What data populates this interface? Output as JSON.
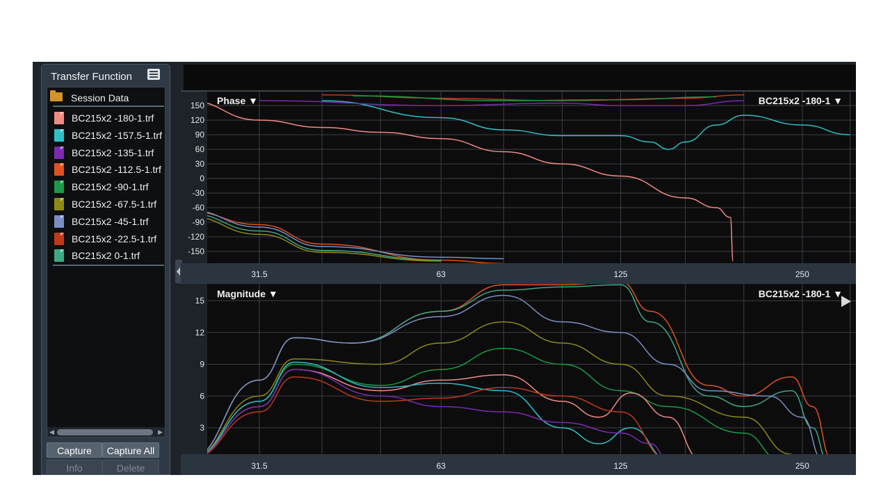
{
  "sidebar": {
    "title": "Transfer Function",
    "menu_icon": "hamburger-menu-icon",
    "folder": {
      "label": "Session Data",
      "icon": "folder-icon",
      "color": "#d4932a"
    },
    "files": [
      {
        "label": "BC215x2 -180-1.trf",
        "color": "#f08b84"
      },
      {
        "label": "BC215x2 -157.5-1.trf",
        "color": "#2cc0c4"
      },
      {
        "label": "BC215x2 -135-1.trf",
        "color": "#7a2bb0"
      },
      {
        "label": "BC215x2 -112.5-1.trf",
        "color": "#e0521f"
      },
      {
        "label": "BC215x2 -90-1.trf",
        "color": "#1a9a47"
      },
      {
        "label": "BC215x2 -67.5-1.trf",
        "color": "#8f8a16"
      },
      {
        "label": "BC215x2 -45-1.trf",
        "color": "#7b8fc2"
      },
      {
        "label": "BC215x2 -22.5-1.trf",
        "color": "#c0391b"
      },
      {
        "label": "BC215x2 0-1.trf",
        "color": "#3ea985"
      }
    ],
    "buttons": {
      "capture": "Capture",
      "capture_all": "Capture All",
      "info": "Info",
      "delete": "Delete"
    }
  },
  "phase_panel": {
    "label": "Phase ▼",
    "trace_selector": "BC215x2 -180-1 ▼"
  },
  "magnitude_panel": {
    "label": "Magnitude ▼",
    "trace_selector": "BC215x2 -180-1 ▼"
  },
  "chart_data": [
    {
      "type": "line",
      "title": "Phase",
      "xlabel": "",
      "ylabel": "",
      "x_scale": "log",
      "x_ticks": [
        "31.5",
        "63",
        "125",
        "250"
      ],
      "y_ticks": [
        150,
        120,
        90,
        60,
        30,
        0,
        -30,
        -60,
        -90,
        -120,
        -150
      ],
      "ylim": [
        -170,
        175
      ],
      "grid": true,
      "series": [
        {
          "color": "#f08b84",
          "points": [
            [
              24,
              160
            ],
            [
              31.5,
              120
            ],
            [
              40,
              105
            ],
            [
              50,
              95
            ],
            [
              63,
              82
            ],
            [
              80,
              55
            ],
            [
              100,
              30
            ],
            [
              125,
              5
            ],
            [
              160,
              -40
            ],
            [
              180,
              -60
            ],
            [
              190,
              -80
            ],
            [
              192,
              -170
            ]
          ]
        },
        {
          "color": "#2cc0c4",
          "points": [
            [
              40,
              160
            ],
            [
              63,
              125
            ],
            [
              80,
              100
            ],
            [
              100,
              88
            ],
            [
              125,
              88
            ],
            [
              140,
              75
            ],
            [
              150,
              60
            ],
            [
              160,
              75
            ],
            [
              180,
              110
            ],
            [
              200,
              130
            ],
            [
              250,
              110
            ],
            [
              300,
              90
            ]
          ]
        },
        {
          "color": "#7a2bb0",
          "points": [
            [
              31.5,
              160
            ],
            [
              63,
              150
            ],
            [
              100,
              155
            ],
            [
              125,
              150
            ],
            [
              160,
              150
            ],
            [
              200,
              160
            ]
          ]
        },
        {
          "color": "#c0391b",
          "points": [
            [
              40,
              172
            ],
            [
              63,
              165
            ],
            [
              100,
              160
            ],
            [
              160,
              165
            ],
            [
              200,
              172
            ]
          ]
        },
        {
          "color": "#1a9a47",
          "points": [
            [
              45,
              170
            ],
            [
              80,
              160
            ],
            [
              125,
              162
            ],
            [
              180,
              168
            ]
          ]
        },
        {
          "color": "#e0521f",
          "points": [
            [
              24,
              -68
            ],
            [
              31.5,
              -95
            ],
            [
              40,
              -135
            ],
            [
              63,
              -168
            ],
            [
              80,
              -175
            ]
          ]
        },
        {
          "color": "#7b8fc2",
          "points": [
            [
              24,
              -65
            ],
            [
              31.5,
              -100
            ],
            [
              40,
              -140
            ],
            [
              63,
              -162
            ],
            [
              80,
              -165
            ]
          ]
        },
        {
          "color": "#3ea985",
          "points": [
            [
              24,
              -72
            ],
            [
              31.5,
              -108
            ],
            [
              40,
              -148
            ],
            [
              63,
              -168
            ]
          ]
        },
        {
          "color": "#8f8a16",
          "points": [
            [
              24,
              -78
            ],
            [
              31.5,
              -115
            ],
            [
              40,
              -152
            ],
            [
              63,
              -170
            ]
          ]
        }
      ]
    },
    {
      "type": "line",
      "title": "Magnitude",
      "xlabel": "",
      "ylabel": "",
      "x_scale": "log",
      "x_ticks": [
        "31.5",
        "63",
        "125",
        "250"
      ],
      "y_ticks": [
        15,
        12,
        9,
        6,
        3
      ],
      "ylim": [
        0,
        16.5
      ],
      "grid": true,
      "series": [
        {
          "color": "#e0521f",
          "points": [
            [
              24,
              0
            ],
            [
              31.5,
              7.5
            ],
            [
              36,
              11.5
            ],
            [
              45,
              11
            ],
            [
              63,
              14
            ],
            [
              80,
              16.5
            ],
            [
              100,
              16.5
            ],
            [
              125,
              16.8
            ],
            [
              140,
              14
            ],
            [
              175,
              7
            ],
            [
              200,
              6
            ],
            [
              240,
              7.8
            ],
            [
              260,
              5
            ],
            [
              280,
              0
            ]
          ]
        },
        {
          "color": "#3ea985",
          "points": [
            [
              24,
              0
            ],
            [
              31.5,
              7.5
            ],
            [
              36,
              11.5
            ],
            [
              45,
              11
            ],
            [
              63,
              14
            ],
            [
              80,
              16
            ],
            [
              100,
              16.3
            ],
            [
              125,
              16.5
            ],
            [
              140,
              13
            ],
            [
              175,
              6
            ],
            [
              200,
              5
            ],
            [
              240,
              6.5
            ],
            [
              260,
              3
            ],
            [
              275,
              0
            ]
          ]
        },
        {
          "color": "#7b8fc2",
          "points": [
            [
              24,
              0
            ],
            [
              31.5,
              7.5
            ],
            [
              36,
              11.5
            ],
            [
              45,
              11
            ],
            [
              63,
              13.5
            ],
            [
              80,
              15.5
            ],
            [
              100,
              13
            ],
            [
              125,
              12
            ],
            [
              150,
              9
            ],
            [
              175,
              6.5
            ],
            [
              220,
              6
            ],
            [
              250,
              4
            ],
            [
              270,
              0
            ]
          ]
        },
        {
          "color": "#8f8a16",
          "points": [
            [
              24,
              0
            ],
            [
              31.5,
              6
            ],
            [
              36,
              9.5
            ],
            [
              50,
              9
            ],
            [
              63,
              11
            ],
            [
              80,
              13
            ],
            [
              100,
              11
            ],
            [
              125,
              9
            ],
            [
              150,
              6
            ],
            [
              200,
              4
            ],
            [
              240,
              0.5
            ]
          ]
        },
        {
          "color": "#1a9a47",
          "points": [
            [
              24,
              0
            ],
            [
              31.5,
              5.5
            ],
            [
              36,
              9
            ],
            [
              50,
              7
            ],
            [
              63,
              8.5
            ],
            [
              80,
              10.5
            ],
            [
              100,
              9
            ],
            [
              125,
              6.5
            ],
            [
              150,
              5
            ],
            [
              200,
              2.5
            ],
            [
              230,
              0
            ]
          ]
        },
        {
          "color": "#f08b84",
          "points": [
            [
              24,
              0
            ],
            [
              31.5,
              5
            ],
            [
              36,
              8.5
            ],
            [
              50,
              6.5
            ],
            [
              63,
              7.5
            ],
            [
              80,
              8
            ],
            [
              100,
              5.5
            ],
            [
              115,
              4
            ],
            [
              130,
              6.3
            ],
            [
              150,
              4
            ],
            [
              170,
              0
            ]
          ]
        },
        {
          "color": "#2cc0c4",
          "points": [
            [
              24,
              0
            ],
            [
              31.5,
              5.5
            ],
            [
              36,
              9.2
            ],
            [
              50,
              6.8
            ],
            [
              63,
              7.2
            ],
            [
              80,
              6.5
            ],
            [
              100,
              3
            ],
            [
              115,
              1.5
            ],
            [
              130,
              3
            ],
            [
              150,
              0
            ]
          ]
        },
        {
          "color": "#7a2bb0",
          "points": [
            [
              24,
              0
            ],
            [
              31.5,
              5
            ],
            [
              36,
              8.5
            ],
            [
              50,
              6
            ],
            [
              63,
              5
            ],
            [
              80,
              4.5
            ],
            [
              100,
              3.5
            ],
            [
              125,
              2.5
            ],
            [
              140,
              1.5
            ],
            [
              150,
              0
            ]
          ]
        },
        {
          "color": "#c0391b",
          "points": [
            [
              24,
              0
            ],
            [
              31.5,
              4.5
            ],
            [
              36,
              7.8
            ],
            [
              50,
              5.5
            ],
            [
              63,
              5.8
            ],
            [
              80,
              6.8
            ],
            [
              100,
              6
            ],
            [
              125,
              4.5
            ],
            [
              150,
              0
            ]
          ]
        }
      ]
    }
  ]
}
